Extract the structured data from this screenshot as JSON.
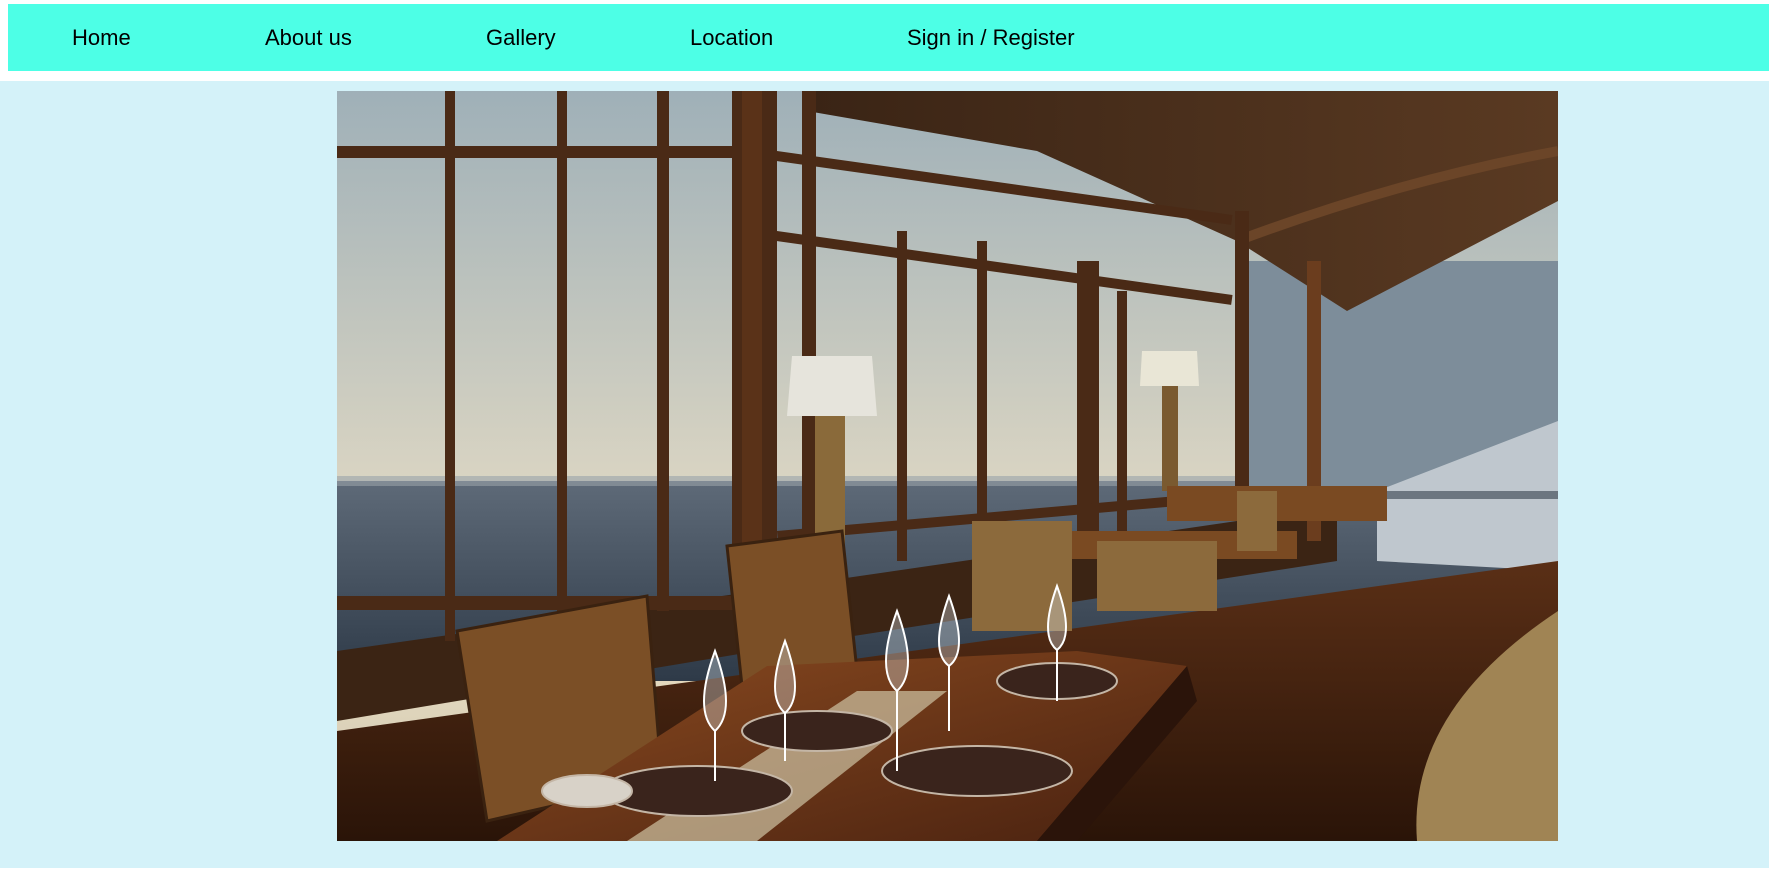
{
  "nav": {
    "items": [
      {
        "label": "Home"
      },
      {
        "label": "About us"
      },
      {
        "label": "Gallery"
      },
      {
        "label": "Location"
      },
      {
        "label": "Sign in / Register"
      }
    ]
  },
  "colors": {
    "nav_background": "#4dffe6",
    "page_background": "#d4f2f9"
  }
}
